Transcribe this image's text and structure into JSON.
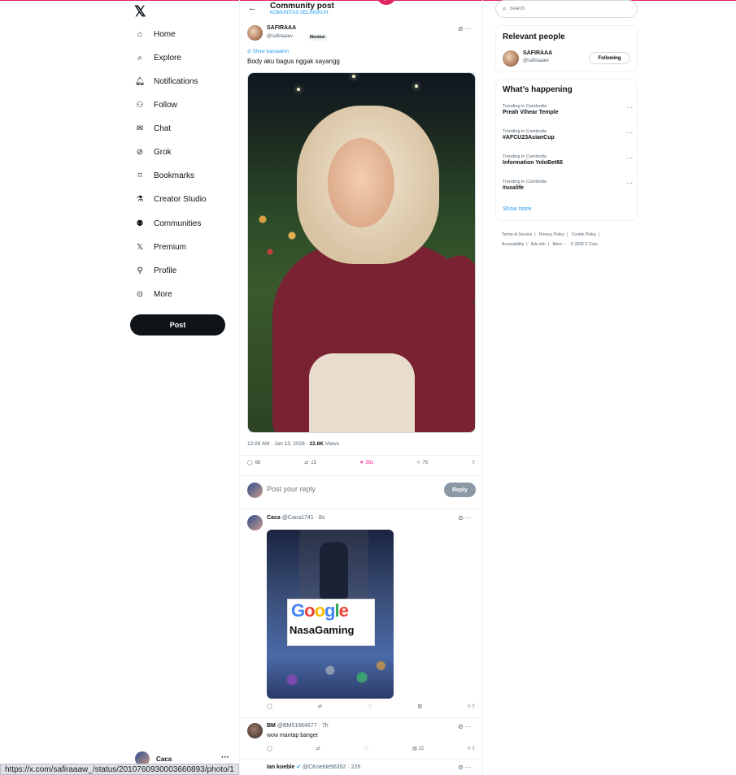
{
  "nav": {
    "logo": "𝕏",
    "items": [
      {
        "label": "Home",
        "icon": "home-icon",
        "glyph": "⌂"
      },
      {
        "label": "Explore",
        "icon": "search-icon",
        "glyph": "⌕"
      },
      {
        "label": "Notifications",
        "icon": "bell-icon",
        "glyph": "🔔︎"
      },
      {
        "label": "Follow",
        "icon": "person-add-icon",
        "glyph": "⚇"
      },
      {
        "label": "Chat",
        "icon": "mail-icon",
        "glyph": "✉"
      },
      {
        "label": "Grok",
        "icon": "grok-icon",
        "glyph": "⊘"
      },
      {
        "label": "Bookmarks",
        "icon": "bookmark-icon",
        "glyph": "⌑"
      },
      {
        "label": "Creator Studio",
        "icon": "flask-icon",
        "glyph": "⚗"
      },
      {
        "label": "Communities",
        "icon": "communities-icon",
        "glyph": "⚉"
      },
      {
        "label": "Premium",
        "icon": "x-logo-icon",
        "glyph": "𝕏"
      },
      {
        "label": "Profile",
        "icon": "person-icon",
        "glyph": "⚲"
      },
      {
        "label": "More",
        "icon": "more-circle-icon",
        "glyph": "⊙"
      }
    ],
    "post_label": "Post",
    "account_name": "Caca",
    "account_more": "···"
  },
  "header": {
    "title": "Community post",
    "subtitle": "KOMUNITAS SELINGKUH",
    "back": "←"
  },
  "post": {
    "author_name": "SAFIRAAA",
    "author_handle": "@safiraaaw",
    "dot": "·",
    "badge": "Member",
    "top_icons": "⊘ ···",
    "translation": "Show translation",
    "text": "Body aku bagus nggak sayangg",
    "time": "12:08 AM · Jan 13, 2026 · ",
    "views_count": "22.8K",
    "views_label": " Views",
    "replies": "66",
    "reposts": "15",
    "likes": "381",
    "bookmarks": "75"
  },
  "reply_box": {
    "placeholder": "Post your reply",
    "button": "Reply"
  },
  "comments": [
    {
      "name": "Caca",
      "handle": "@Caca1741 · 8s",
      "ad_top": "Google",
      "ad_bottom": "NasaGaming",
      "views": ""
    },
    {
      "name": "BM",
      "handle": "@BM51664677 · 7h",
      "text": "wow mantap banget",
      "views": "22"
    },
    {
      "name": "Ian koeble",
      "handle": "@CKoeble56352 · 22h"
    }
  ],
  "search": {
    "placeholder": "Search"
  },
  "relevant": {
    "title": "Relevant people",
    "name": "SAFIRAAA",
    "handle": "@safiraaaw",
    "button": "Following"
  },
  "happening": {
    "title": "What’s happening",
    "trends": [
      {
        "context": "Trending in Cambodia",
        "name": "Preah Vihear Temple"
      },
      {
        "context": "Trending in Cambodia",
        "name": "#AFCU23AsianCup"
      },
      {
        "context": "Trending in Cambodia",
        "name": "Information YoloBet66"
      },
      {
        "context": "Trending in Cambodia",
        "name": "#usalife"
      }
    ],
    "show_more": "Show more"
  },
  "footer": {
    "links": [
      "Terms of Service",
      "|",
      "Privacy Policy",
      "|",
      "Cookie Policy",
      "|",
      "Accessibility",
      "|",
      "Ads info",
      "|",
      "More ···",
      "© 2026 X Corp."
    ]
  },
  "status_url": "https://x.com/safiraaaw_/status/2010760930003660893/photo/1",
  "colors": {
    "accent": "#1d9bf0",
    "like": "#f91880",
    "text": "#0f1419"
  }
}
